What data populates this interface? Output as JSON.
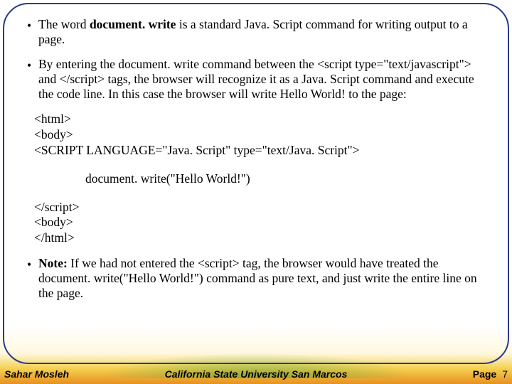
{
  "bullets": {
    "b1_pre": "The word ",
    "b1_bold": "document. write",
    "b1_post": " is a standard Java. Script command for writing output to a page.",
    "b2": "By entering the document. write command between the <script type=\"text/javascript\"> and </script> tags, the browser will recognize it as a Java. Script command and execute the code line. In this case the browser will write Hello World! to the page:",
    "b3_bold": "Note:",
    "b3_post": " If we had not entered the <script> tag, the browser would have treated the document. write(\"Hello World!\") command as pure text, and just write the entire line on the page."
  },
  "code": {
    "l1": "<html>",
    "l2": "<body>",
    "l3": " <SCRIPT LANGUAGE=\"Java. Script\"  type=\"text/Java. Script\">",
    "l4": "document. write(\"Hello World!\")",
    "l5": "</script>",
    "l6": "<body>",
    "l7": "</html>"
  },
  "footer": {
    "left": "Sahar Mosleh",
    "center": "California State University San Marcos",
    "right_label": "Page",
    "page_number": "7"
  }
}
